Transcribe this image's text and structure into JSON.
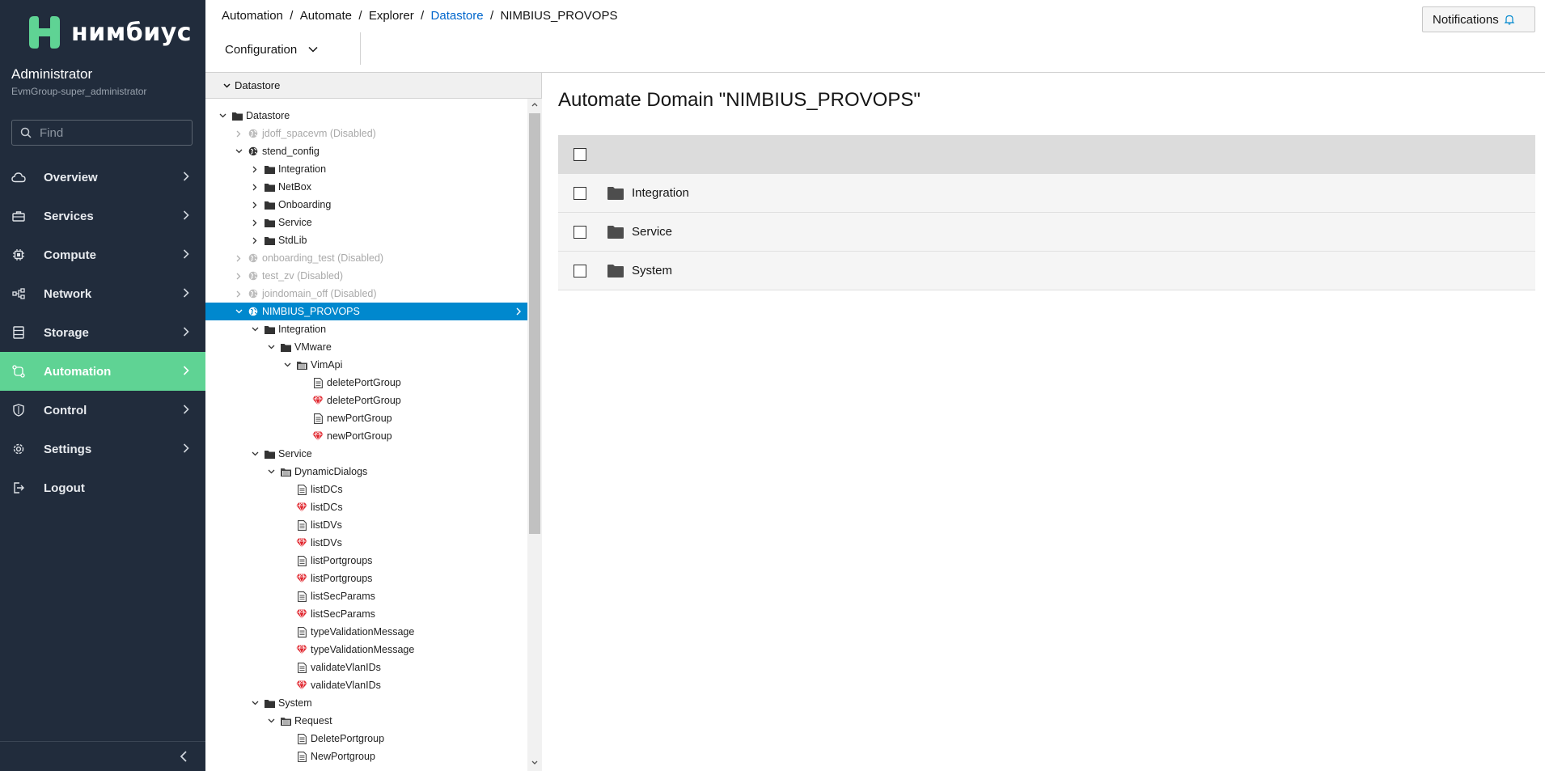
{
  "app": {
    "brand": "нимбиус",
    "accent_color": "#5fd394",
    "sidebar_color": "#212c3c"
  },
  "user": {
    "name": "Administrator",
    "group": "EvmGroup-super_administrator"
  },
  "search": {
    "placeholder": "Find"
  },
  "nav": [
    {
      "label": "Overview",
      "icon": "cloud-icon"
    },
    {
      "label": "Services",
      "icon": "briefcase-icon"
    },
    {
      "label": "Compute",
      "icon": "cpu-icon"
    },
    {
      "label": "Network",
      "icon": "network-icon"
    },
    {
      "label": "Storage",
      "icon": "storage-icon"
    },
    {
      "label": "Automation",
      "icon": "automation-icon",
      "active": true
    },
    {
      "label": "Control",
      "icon": "shield-icon"
    },
    {
      "label": "Settings",
      "icon": "gear-icon"
    },
    {
      "label": "Logout",
      "icon": "logout-icon"
    }
  ],
  "breadcrumb": [
    "Automation",
    "Automate",
    "Explorer",
    "Datastore",
    "NIMBIUS_PROVOPS"
  ],
  "breadcrumb_sep": "/",
  "header": {
    "notifications_label": "Notifications",
    "configuration_label": "Configuration"
  },
  "tree": {
    "header": "Datastore",
    "nodes": [
      {
        "label": "Datastore",
        "level": 0,
        "toggle": "expanded",
        "icon": "folder-icon"
      },
      {
        "label": "jdoff_spacevm (Disabled)",
        "level": 1,
        "toggle": "collapsed",
        "icon": "globe-icon",
        "disabled": true
      },
      {
        "label": "stend_config",
        "level": 1,
        "toggle": "expanded",
        "icon": "globe-icon"
      },
      {
        "label": "Integration",
        "level": 2,
        "toggle": "collapsed",
        "icon": "folder-icon"
      },
      {
        "label": "NetBox",
        "level": 2,
        "toggle": "collapsed",
        "icon": "folder-icon"
      },
      {
        "label": "Onboarding",
        "level": 2,
        "toggle": "collapsed",
        "icon": "folder-icon"
      },
      {
        "label": "Service",
        "level": 2,
        "toggle": "collapsed",
        "icon": "folder-icon"
      },
      {
        "label": "StdLib",
        "level": 2,
        "toggle": "collapsed",
        "icon": "folder-icon"
      },
      {
        "label": "onboarding_test (Disabled)",
        "level": 1,
        "toggle": "collapsed",
        "icon": "globe-icon",
        "disabled": true
      },
      {
        "label": "test_zv (Disabled)",
        "level": 1,
        "toggle": "collapsed",
        "icon": "globe-icon",
        "disabled": true
      },
      {
        "label": "joindomain_off (Disabled)",
        "level": 1,
        "toggle": "collapsed",
        "icon": "globe-icon",
        "disabled": true
      },
      {
        "label": "NIMBIUS_PROVOPS",
        "level": 1,
        "toggle": "expanded",
        "icon": "globe-icon",
        "selected": true
      },
      {
        "label": "Integration",
        "level": 2,
        "toggle": "expanded",
        "icon": "folder-icon"
      },
      {
        "label": "VMware",
        "level": 3,
        "toggle": "expanded",
        "icon": "folder-icon"
      },
      {
        "label": "VimApi",
        "level": 4,
        "toggle": "expanded",
        "icon": "class-icon"
      },
      {
        "label": "deletePortGroup",
        "level": 5,
        "toggle": "none",
        "icon": "document-icon"
      },
      {
        "label": "deletePortGroup",
        "level": 5,
        "toggle": "none",
        "icon": "ruby-icon"
      },
      {
        "label": "newPortGroup",
        "level": 5,
        "toggle": "none",
        "icon": "document-icon"
      },
      {
        "label": "newPortGroup",
        "level": 5,
        "toggle": "none",
        "icon": "ruby-icon"
      },
      {
        "label": "Service",
        "level": 2,
        "toggle": "expanded",
        "icon": "folder-icon"
      },
      {
        "label": "DynamicDialogs",
        "level": 3,
        "toggle": "expanded",
        "icon": "class-icon"
      },
      {
        "label": "listDCs",
        "level": 4,
        "toggle": "none",
        "icon": "document-icon"
      },
      {
        "label": "listDCs",
        "level": 4,
        "toggle": "none",
        "icon": "ruby-icon"
      },
      {
        "label": "listDVs",
        "level": 4,
        "toggle": "none",
        "icon": "document-icon"
      },
      {
        "label": "listDVs",
        "level": 4,
        "toggle": "none",
        "icon": "ruby-icon"
      },
      {
        "label": "listPortgroups",
        "level": 4,
        "toggle": "none",
        "icon": "document-icon"
      },
      {
        "label": "listPortgroups",
        "level": 4,
        "toggle": "none",
        "icon": "ruby-icon"
      },
      {
        "label": "listSecParams",
        "level": 4,
        "toggle": "none",
        "icon": "document-icon"
      },
      {
        "label": "listSecParams",
        "level": 4,
        "toggle": "none",
        "icon": "ruby-icon"
      },
      {
        "label": "typeValidationMessage",
        "level": 4,
        "toggle": "none",
        "icon": "document-icon"
      },
      {
        "label": "typeValidationMessage",
        "level": 4,
        "toggle": "none",
        "icon": "ruby-icon"
      },
      {
        "label": "validateVlanIDs",
        "level": 4,
        "toggle": "none",
        "icon": "document-icon"
      },
      {
        "label": "validateVlanIDs",
        "level": 4,
        "toggle": "none",
        "icon": "ruby-icon"
      },
      {
        "label": "System",
        "level": 2,
        "toggle": "expanded",
        "icon": "folder-icon"
      },
      {
        "label": "Request",
        "level": 3,
        "toggle": "expanded",
        "icon": "class-icon"
      },
      {
        "label": "DeletePortgroup",
        "level": 4,
        "toggle": "none",
        "icon": "document-icon"
      },
      {
        "label": "NewPortgroup",
        "level": 4,
        "toggle": "none",
        "icon": "document-icon"
      }
    ]
  },
  "main": {
    "title": "Automate Domain \"NIMBIUS_PROVOPS\"",
    "rows": [
      "Integration",
      "Service",
      "System"
    ]
  }
}
